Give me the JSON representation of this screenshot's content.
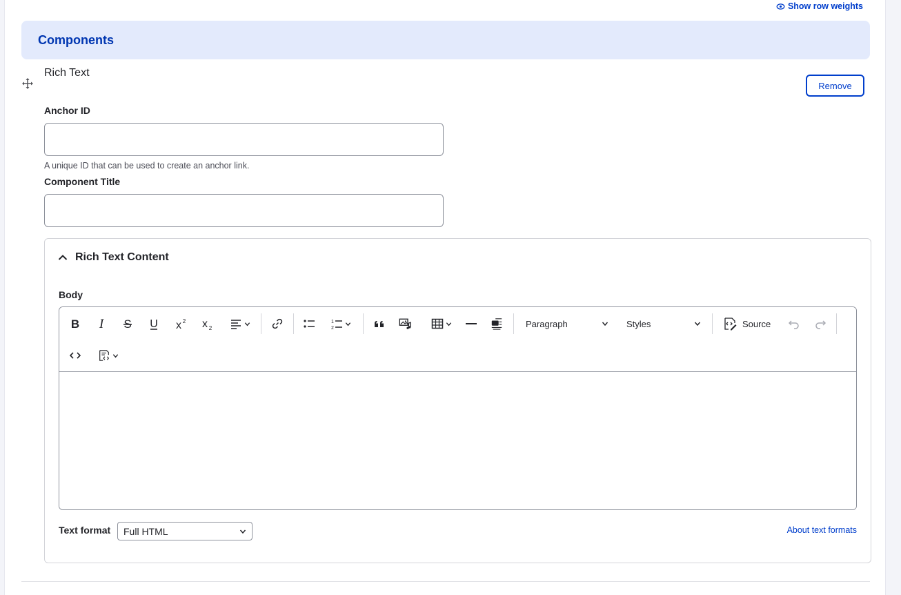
{
  "header": {
    "row_weights_label": "Show row weights",
    "section_title": "Components"
  },
  "component": {
    "title": "Rich Text",
    "remove_label": "Remove",
    "anchor_label": "Anchor ID",
    "anchor_value": "",
    "anchor_description": "A unique ID that can be used to create an anchor link.",
    "title_label": "Component Title",
    "title_value": ""
  },
  "rich_text": {
    "summary": "Rich Text Content",
    "body_label": "Body",
    "toolbar": {
      "heading_dropdown": "Paragraph",
      "styles_dropdown": "Styles",
      "source_label": "Source"
    },
    "text_format_label": "Text format",
    "text_format_value": "Full HTML",
    "about_link": "About text formats"
  },
  "colors": {
    "accent": "#003ecc",
    "header_bg": "#e3eafc",
    "header_text": "#0036b1"
  }
}
